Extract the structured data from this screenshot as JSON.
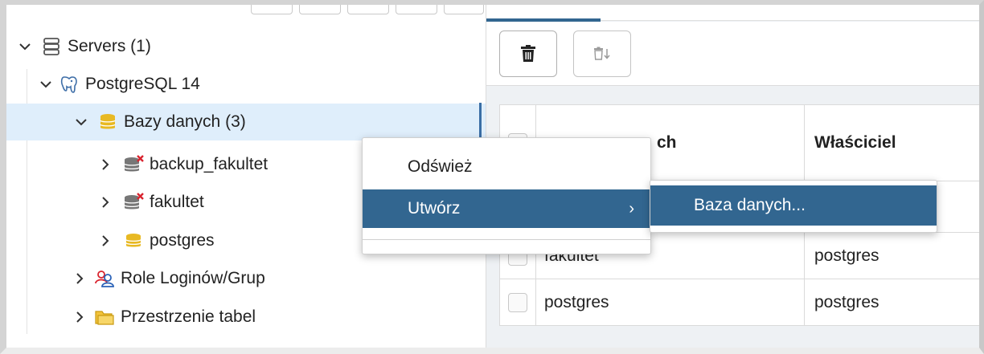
{
  "tree": {
    "items": [
      {
        "label": "Servers (1)",
        "chevron": "expanded",
        "icon": "server-stack-icon"
      },
      {
        "label": "PostgreSQL 14",
        "chevron": "expanded",
        "icon": "elephant-icon"
      },
      {
        "label": "Bazy danych (3)",
        "chevron": "expanded",
        "icon": "databases-icon",
        "selected": true
      },
      {
        "label": "backup_fakultet",
        "chevron": "collapsed",
        "icon": "database-disconnected-icon"
      },
      {
        "label": "fakultet",
        "chevron": "collapsed",
        "icon": "database-disconnected-icon"
      },
      {
        "label": "postgres",
        "chevron": "collapsed",
        "icon": "database-icon"
      },
      {
        "label": "Role Loginów/Grup",
        "chevron": "collapsed",
        "icon": "roles-icon"
      },
      {
        "label": "Przestrzenie tabel",
        "chevron": "collapsed",
        "icon": "folder-icon"
      }
    ]
  },
  "toolbar": {
    "delete_icon": "trash-icon",
    "delete_cascade_icon": "trash-cascade-icon"
  },
  "grid": {
    "headers": [
      "ch",
      "Właściciel"
    ],
    "rows": [
      [
        "",
        ""
      ],
      [
        "fakultet",
        "postgres"
      ],
      [
        "postgres",
        "postgres"
      ]
    ]
  },
  "context_menu": {
    "items": [
      {
        "label": "Odśwież"
      },
      {
        "label": "Utwórz",
        "has_submenu": true,
        "arrow": "›"
      }
    ],
    "submenu": {
      "label": "Baza danych..."
    }
  },
  "colors": {
    "accent": "#326690",
    "selection": "#dfeefb",
    "database_yellow": "#e8b923",
    "disconnected_red": "#d9232e"
  }
}
